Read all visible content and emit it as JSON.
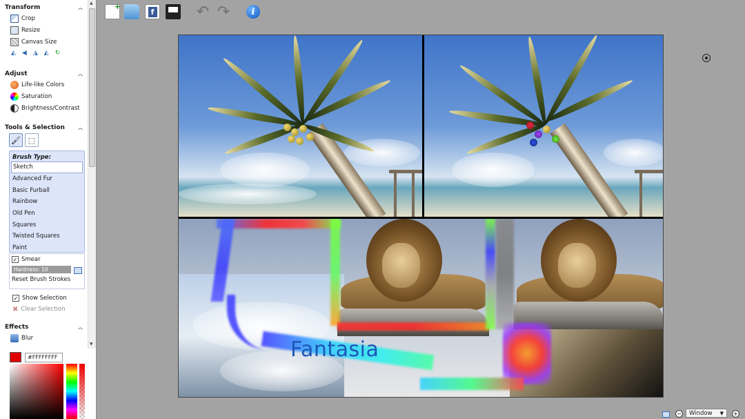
{
  "sidebar": {
    "transform": {
      "title": "Transform",
      "items": [
        "Crop",
        "Resize",
        "Canvas Size"
      ]
    },
    "adjust": {
      "title": "Adjust",
      "items": [
        "Life-like Colors",
        "Saturation",
        "Brightness/Contrast"
      ]
    },
    "tools": {
      "title": "Tools & Selection",
      "brush_type_label": "Brush Type:",
      "brush_types": [
        "Sketch",
        "Advanced Fur",
        "Basic Furball",
        "Rainbow",
        "Old Pen",
        "Squares",
        "Twisted Squares",
        "Paint"
      ],
      "selected_brush": "Sketch",
      "smear_label": "Smear",
      "smear_checked": true,
      "hardness_label": "Hardness: 10",
      "reset_label": "Reset Brush Strokes",
      "show_selection_label": "Show Selection",
      "show_selection_checked": true,
      "clear_selection_label": "Clear Selection"
    },
    "effects": {
      "title": "Effects",
      "items": [
        "Blur"
      ]
    },
    "color": {
      "hex": "#FFFFFFFF",
      "swatch": "#e00000"
    }
  },
  "toolbar": {
    "icons": [
      "new-image-icon",
      "open-folder-icon",
      "facebook-icon",
      "save-icon",
      "undo-icon",
      "redo-icon",
      "info-icon"
    ]
  },
  "canvas": {
    "overlay_text": "Fantasia"
  },
  "status": {
    "zoom_mode": "Window"
  }
}
